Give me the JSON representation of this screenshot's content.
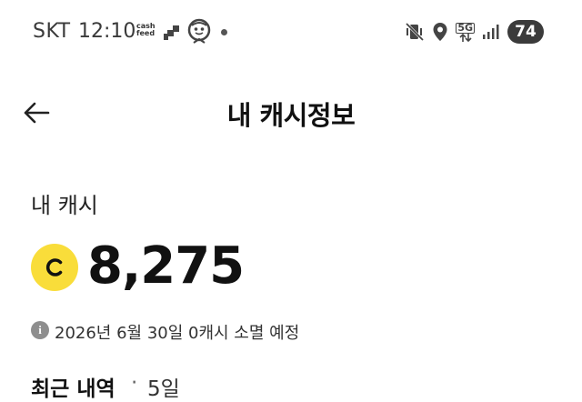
{
  "status_bar": {
    "carrier": "SKT",
    "time": "12:10",
    "cashfeed_top": "cash",
    "cashfeed_bottom": "feed",
    "network": "5G",
    "battery": "74"
  },
  "header": {
    "title": "내 캐시정보",
    "back_icon": "arrow-left-icon"
  },
  "cash": {
    "label": "내 캐시",
    "coin_letter": "C",
    "amount": "8,275",
    "coin_color": "#f9dd3a"
  },
  "expiry": {
    "info_glyph": "i",
    "text": "2026년 6월 30일 0캐시 소멸 예정"
  },
  "recent": {
    "heading": "최근 내역",
    "separator": "·",
    "period": "5일"
  }
}
